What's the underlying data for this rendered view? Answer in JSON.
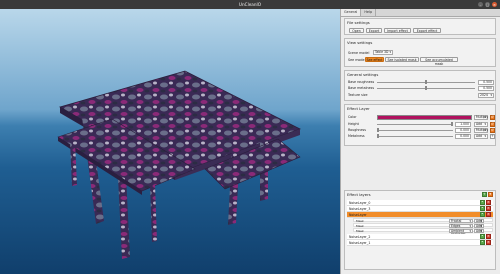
{
  "window": {
    "title": "UnCleanIO"
  },
  "tabs": [
    {
      "label": "General"
    },
    {
      "label": "Help"
    }
  ],
  "file_settings": {
    "title": "File settings",
    "buttons": [
      {
        "label": "Open"
      },
      {
        "label": "Export"
      },
      {
        "label": "Import effect"
      },
      {
        "label": "Export effect"
      }
    ]
  },
  "view_settings": {
    "title": "View settings",
    "scene_model_label": "Scene model",
    "scene_model_value": "Table 3D",
    "see_mode_label": "See mode",
    "see_mode_buttons": [
      {
        "label": "See effect"
      },
      {
        "label": "See isolated mask"
      },
      {
        "label": "See accumulated mask"
      }
    ]
  },
  "general_settings": {
    "title": "General settings",
    "rows": [
      {
        "label": "Base roughness",
        "value": "0.500",
        "fraction": 0.5
      },
      {
        "label": "Base metalness",
        "value": "0.500",
        "fraction": 0.5
      }
    ],
    "texture_size_label": "Texture size",
    "texture_size_value": "2024"
  },
  "effect_layer": {
    "title": "Effect Layer",
    "color_label": "Color",
    "color_value": "#b0135f",
    "color_blend": "Multiply",
    "rows": [
      {
        "label": "Height",
        "value": "1.000",
        "mode": "Add",
        "fraction": 0.99
      },
      {
        "label": "Roughness",
        "value": "0.000",
        "mode": "Multiply",
        "fraction": 0.0
      },
      {
        "label": "Metalness",
        "value": "0.000",
        "mode": "Add",
        "fraction": 0.0
      }
    ]
  },
  "effect_layers": {
    "title": "Effect layers",
    "layers": [
      {
        "name": "NoiseLayer_0",
        "selected": false
      },
      {
        "name": "NoiseLayer_3",
        "selected": false
      },
      {
        "name": "NoiseLayer",
        "selected": true
      },
      {
        "name": "NoiseLayer_2",
        "selected": false
      },
      {
        "name": "NoiseLayer_1",
        "selected": false
      }
    ],
    "masks": [
      {
        "name": "Mask",
        "type": "Fractal"
      },
      {
        "name": "Mask",
        "type": "Edges"
      },
      {
        "name": "Mask",
        "type": "Ambient occlusion"
      }
    ],
    "dropdown_value": "Add"
  }
}
